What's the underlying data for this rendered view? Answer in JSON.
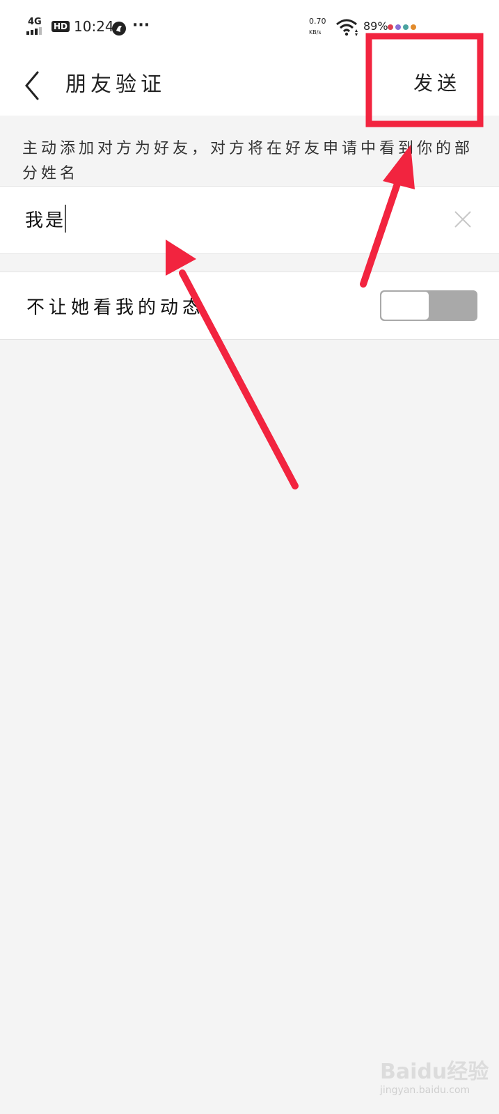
{
  "status_bar": {
    "network": "4G",
    "hd": "HD",
    "time": "10:24",
    "more": "···",
    "speed_value": "0.70",
    "speed_unit": "KB/s",
    "battery": "89%"
  },
  "header": {
    "title": "朋友验证",
    "send_label": "发送"
  },
  "hint": {
    "text": "主动添加对方为好友，对方将在好友申请中看到你的部分姓名"
  },
  "verification_input": {
    "value": "我是"
  },
  "privacy_toggle": {
    "label": "不让她看我的动态",
    "on": false
  },
  "watermark": {
    "brand": "Baidu经验",
    "url": "jingyan.baidu.com"
  },
  "colors": {
    "annotation_red": "#f2243f",
    "toggle_track": "#a9a9a9",
    "background": "#f4f4f4"
  }
}
